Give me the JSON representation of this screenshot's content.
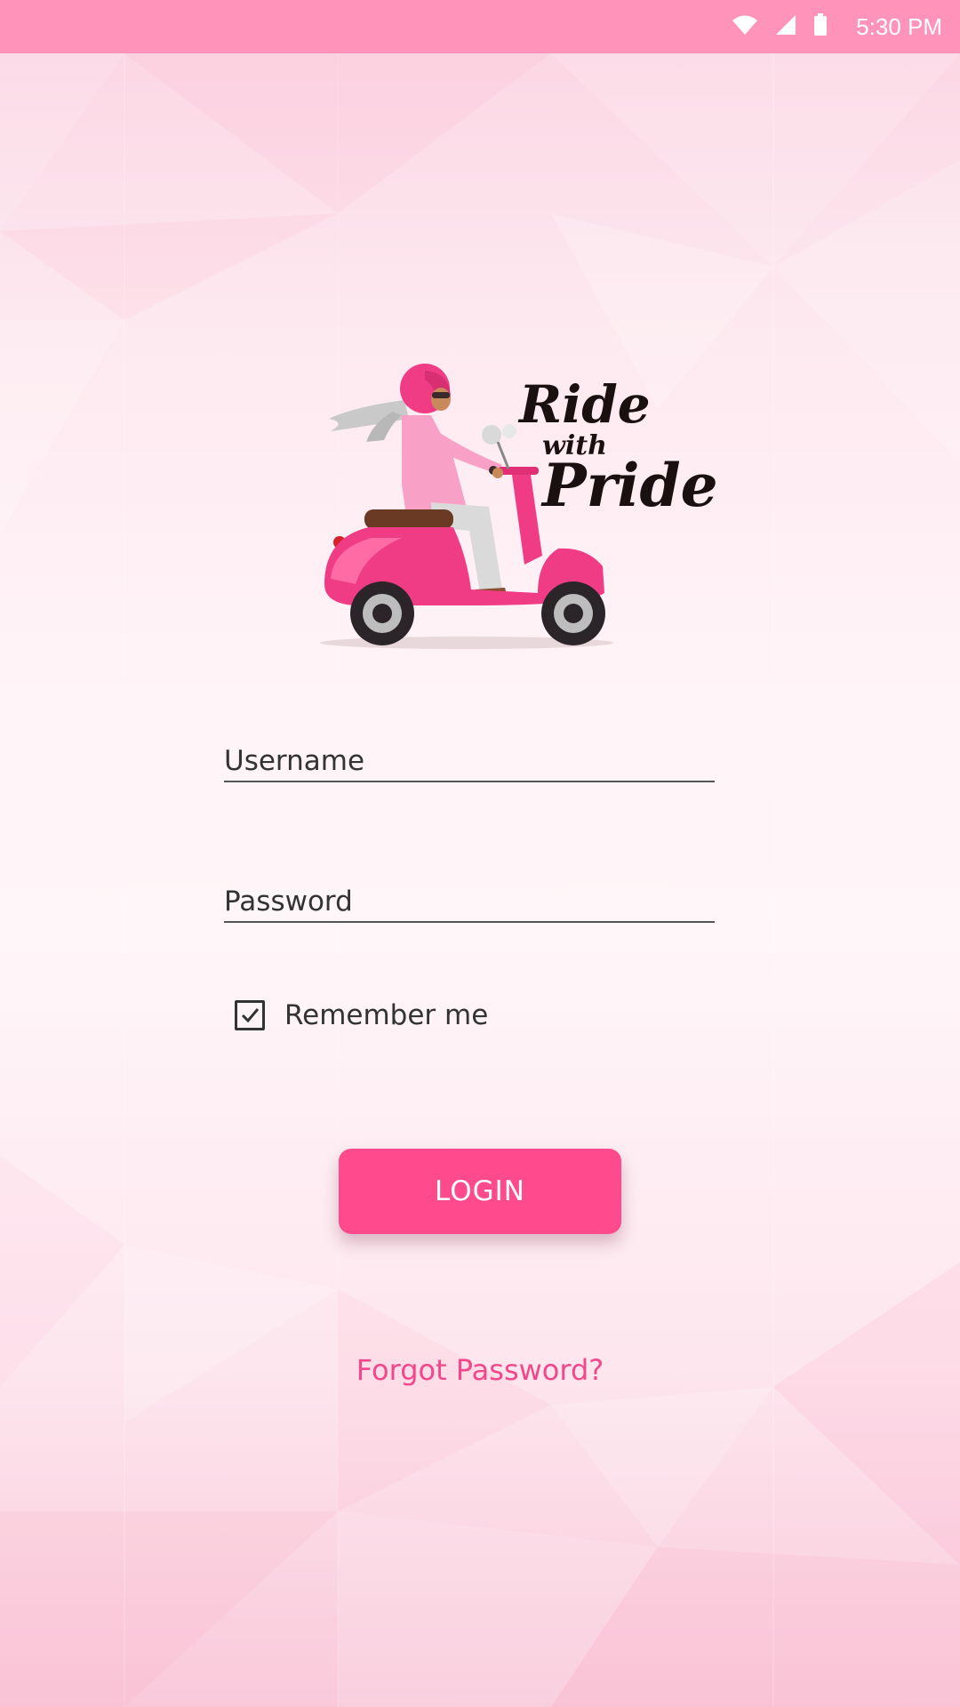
{
  "status_bar": {
    "time": "5:30 PM",
    "icons": [
      "wifi-icon",
      "cellular-signal-icon",
      "battery-icon"
    ],
    "background": "#ff93b9"
  },
  "logo": {
    "line1": "Ride",
    "line2": "with",
    "line3": "Pride"
  },
  "form": {
    "username_placeholder": "Username",
    "username_value": "",
    "password_placeholder": "Password",
    "password_value": "",
    "remember_label": "Remember me",
    "remember_checked": true
  },
  "actions": {
    "login_label": "LOGIN",
    "forgot_label": "Forgot Password?"
  },
  "colors": {
    "accent": "#ff4a8e",
    "link": "#f2478b",
    "status_bar": "#ff93b9"
  }
}
